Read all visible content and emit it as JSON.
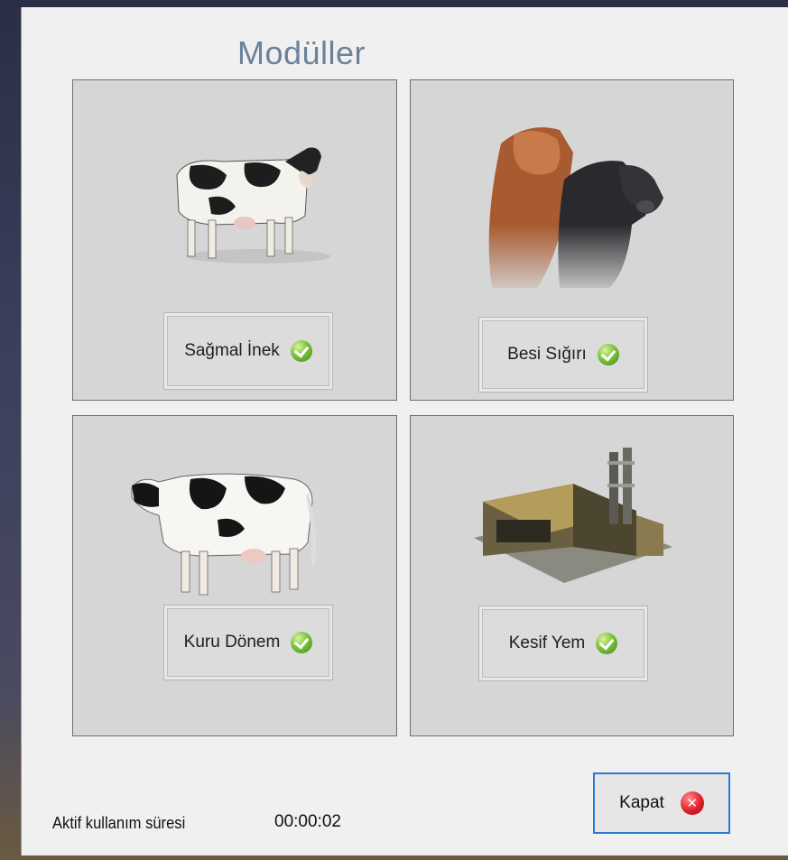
{
  "window": {
    "title": "Modüller"
  },
  "modules": [
    {
      "label": "Sağmal İnek",
      "icon": "dairy-cow-image",
      "status_icon": "check-icon"
    },
    {
      "label": "Besi Sığırı",
      "icon": "beef-cattle-image",
      "status_icon": "check-icon"
    },
    {
      "label": "Kuru Dönem",
      "icon": "dry-cow-image",
      "status_icon": "check-icon"
    },
    {
      "label": "Kesif Yem",
      "icon": "feed-factory-image",
      "status_icon": "check-icon"
    }
  ],
  "footer": {
    "usage_label": "Aktif kullanım süresi",
    "usage_time": "00:00:02",
    "close_label": "Kapat",
    "close_icon": "close-icon"
  },
  "colors": {
    "title": "#6b8299",
    "panel_bg": "#d6d6d6",
    "accent_border": "#2b7bd2"
  }
}
